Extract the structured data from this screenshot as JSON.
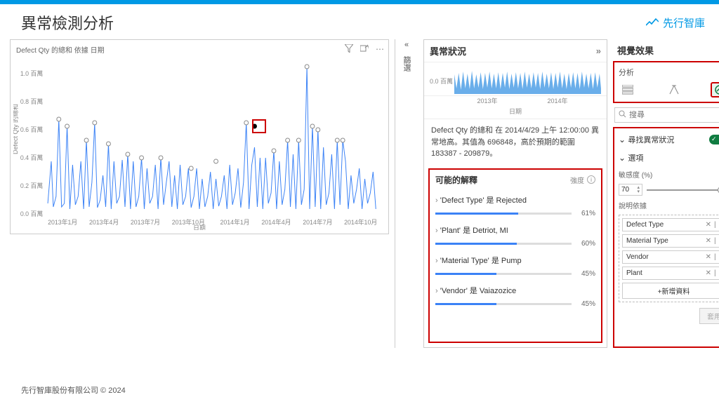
{
  "header": {
    "title": "異常檢測分析",
    "logo_text": "先行智庫"
  },
  "chart": {
    "title": "Defect Qty 的總和 依據 日期",
    "x_title": "日期",
    "y_title": "Defect Qty 的總和",
    "x_ticks": [
      "2013年1月",
      "2013年4月",
      "2013年7月",
      "2013年10月",
      "2014年1月",
      "2014年4月",
      "2014年7月",
      "2014年10月"
    ],
    "y_ticks": [
      "0.0 百萬",
      "0.2 百萬",
      "0.4 百萬",
      "0.6 百萬",
      "0.8 百萬",
      "1.0 百萬"
    ]
  },
  "chart_data": {
    "type": "line",
    "title": "Defect Qty 的總和 依據 日期",
    "xlabel": "日期",
    "ylabel": "Defect Qty 的總和",
    "ylim": [
      0,
      1000000
    ],
    "y_unit": "百萬",
    "anomaly_markers_note": "grey dots mark high spikes; red box highlights the 2014-04-29 anomaly",
    "series": [
      {
        "name": "Defect Qty 的總和",
        "x_approx_daily": "2013-01 to 2014-12",
        "sampled_peaks": [
          {
            "x": "2013-01",
            "y": 420000
          },
          {
            "x": "2013-02",
            "y": 620000
          },
          {
            "x": "2013-03",
            "y": 330000
          },
          {
            "x": "2013-04",
            "y": 580000
          },
          {
            "x": "2013-06",
            "y": 420000
          },
          {
            "x": "2013-08",
            "y": 400000
          },
          {
            "x": "2013-10",
            "y": 380000
          },
          {
            "x": "2013-12",
            "y": 350000
          },
          {
            "x": "2014-02",
            "y": 300000
          },
          {
            "x": "2014-04-29",
            "y": 696848,
            "anomaly": true
          },
          {
            "x": "2014-06",
            "y": 1050000
          },
          {
            "x": "2014-07",
            "y": 550000
          },
          {
            "x": "2014-08",
            "y": 540000
          },
          {
            "x": "2014-10",
            "y": 380000
          },
          {
            "x": "2014-12",
            "y": 330000
          }
        ],
        "baseline_approx": 80000
      }
    ]
  },
  "collapse_bar": {
    "label": "篩選"
  },
  "anomaly": {
    "header": "異常狀況",
    "mini_y": "0.0 百萬",
    "mini_ticks": [
      "2013年",
      "2014年"
    ],
    "mini_caption": "日期",
    "description": "Defect Qty 的總和 在 2014/4/29 上午 12:00:00 異常地高。其值為 696848，高於預期的範圍 183387 - 209879。",
    "explain_header": "可能的解釋",
    "strength_label": "強度",
    "items": [
      {
        "label": "'Defect Type' 是 Rejected",
        "pct": "61%"
      },
      {
        "label": "'Plant' 是 Detriot, MI",
        "pct": "60%"
      },
      {
        "label": "'Material Type' 是 Pump",
        "pct": "45%"
      },
      {
        "label": "'Vendor' 是 Vaiazozice",
        "pct": "45%"
      }
    ]
  },
  "viz": {
    "header": "視覺效果",
    "sub": "分析",
    "search_placeholder": "搜尋",
    "find_anomaly": "尋找異常狀況",
    "options_label": "選項",
    "sensitivity_label": "敏感度 (%)",
    "sensitivity_value": "70",
    "explain_by_label": "說明依據",
    "fields": [
      "Defect Type",
      "Material Type",
      "Vendor",
      "Plant"
    ],
    "add_field": "+新增資料",
    "apply": "套用"
  },
  "footer": "先行智庫股份有限公司 © 2024"
}
